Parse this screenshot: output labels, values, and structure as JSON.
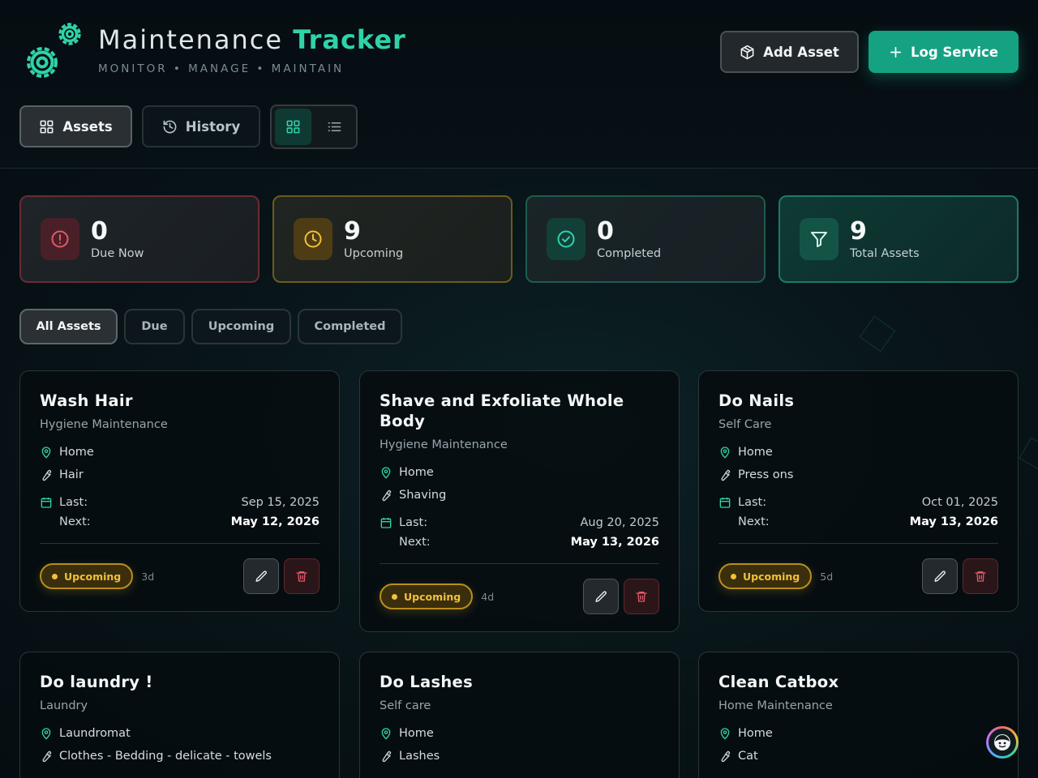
{
  "app": {
    "title_main": "Maintenance",
    "title_accent": "Tracker",
    "subtitle": "MONITOR • MANAGE • MAINTAIN"
  },
  "header": {
    "add_asset_label": "Add Asset",
    "log_service_label": "Log Service"
  },
  "nav": {
    "assets_label": "Assets",
    "history_label": "History"
  },
  "stats": [
    {
      "value": "0",
      "label": "Due Now"
    },
    {
      "value": "9",
      "label": "Upcoming"
    },
    {
      "value": "0",
      "label": "Completed"
    },
    {
      "value": "9",
      "label": "Total Assets"
    }
  ],
  "filters": [
    "All Assets",
    "Due",
    "Upcoming",
    "Completed"
  ],
  "labels": {
    "last": "Last:",
    "next": "Next:"
  },
  "cards": [
    {
      "title": "Wash Hair",
      "category": "Hygiene Maintenance",
      "location": "Home",
      "detail": "Hair",
      "last": "Sep 15, 2025",
      "next": "May 12, 2026",
      "status": "Upcoming",
      "days": "3d"
    },
    {
      "title": "Shave and Exfoliate Whole Body",
      "category": "Hygiene Maintenance",
      "location": "Home",
      "detail": "Shaving",
      "last": "Aug 20, 2025",
      "next": "May 13, 2026",
      "status": "Upcoming",
      "days": "4d"
    },
    {
      "title": "Do Nails",
      "category": "Self Care",
      "location": "Home",
      "detail": "Press ons",
      "last": "Oct 01, 2025",
      "next": "May 13, 2026",
      "status": "Upcoming",
      "days": "5d"
    },
    {
      "title": "Do laundry !",
      "category": "Laundry",
      "location": "Laundromat",
      "detail": "Clothes - Bedding - delicate - towels"
    },
    {
      "title": "Do Lashes",
      "category": "Self care",
      "location": "Home",
      "detail": "Lashes"
    },
    {
      "title": "Clean Catbox",
      "category": "Home Maintenance",
      "location": "Home",
      "detail": "Cat"
    }
  ],
  "colors": {
    "accent": "#2fd3a6",
    "primary_button": "#14a283",
    "due": "#e05a6a",
    "upcoming": "#f0c13a",
    "completed": "#2fd3a6"
  }
}
